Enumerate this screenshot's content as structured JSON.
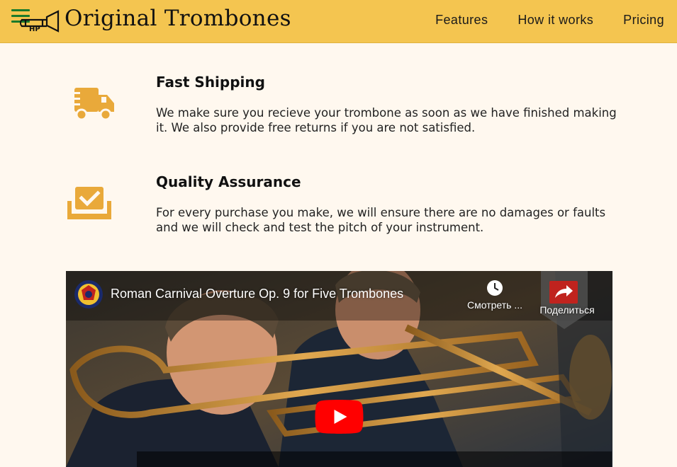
{
  "header": {
    "brand": "Original Trombones",
    "nav": [
      {
        "label": "Features"
      },
      {
        "label": "How it works"
      },
      {
        "label": "Pricing"
      }
    ]
  },
  "features": [
    {
      "icon": "shipping-truck-icon",
      "title": "Fast Shipping",
      "text": "We make sure you recieve your trombone as soon as we have finished making it. We also provide free returns if you are not satisfied."
    },
    {
      "icon": "quality-check-icon",
      "title": "Quality Assurance",
      "text": "For every purchase you make, we will ensure there are no damages or faults and we will check and test the pitch of your instrument."
    }
  ],
  "video": {
    "title": "Roman Carnival Overture Op. 9 for Five Trombones",
    "watch_later_label": "Смотреть ...",
    "share_label": "Поделиться"
  },
  "colors": {
    "header_bg": "#f4c550",
    "page_bg": "#fff8ef",
    "icon_accent": "#e9a93a",
    "hamburger": "#1a7a2b",
    "yt_red": "#ff0000"
  }
}
